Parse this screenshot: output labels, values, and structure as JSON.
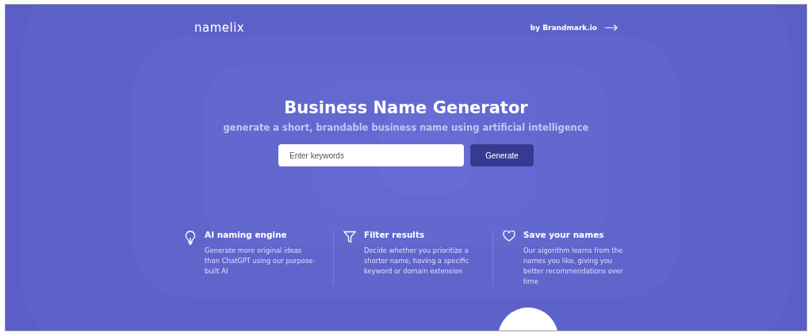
{
  "header": {
    "logo": "namelix",
    "byline": "by Brandmark.io"
  },
  "hero": {
    "title": "Business Name Generator",
    "subtitle": "generate a short, brandable business name using artificial intelligence"
  },
  "search": {
    "placeholder": "Enter keywords",
    "button": "Generate"
  },
  "features": [
    {
      "title": "AI naming engine",
      "text": "Generate more original ideas than ChatGPT using our purpose-built AI"
    },
    {
      "title": "Filter results",
      "text": "Decide whether you prioritize a shorter name, having a specific keyword or domain extension"
    },
    {
      "title": "Save your names",
      "text": "Our algorithm learns from the names you like, giving you better recommendations over time"
    }
  ]
}
